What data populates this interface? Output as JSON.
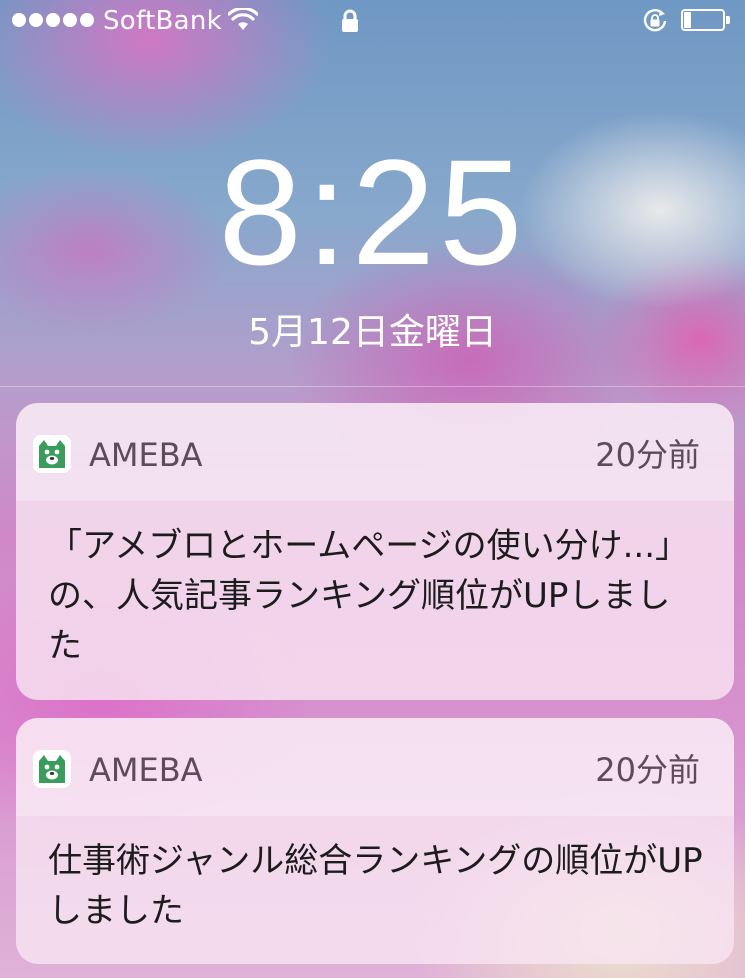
{
  "status_bar": {
    "carrier": "SoftBank",
    "signal_bars": 5,
    "battery_level": 0.2
  },
  "lock_screen": {
    "time": "8:25",
    "date": "5月12日金曜日"
  },
  "notifications": [
    {
      "app_name": "AMEBA",
      "time_ago": "20分前",
      "message": "「アメブロとホームページの使い分け...」の、人気記事ランキング順位がUPしました"
    },
    {
      "app_name": "AMEBA",
      "time_ago": "20分前",
      "message": "仕事術ジャンル総合ランキングの順位がUPしました"
    }
  ],
  "colors": {
    "app_icon_accent": "#3a9c5a",
    "card_background": "#f8e4f2",
    "status_foreground": "#ffffff"
  }
}
